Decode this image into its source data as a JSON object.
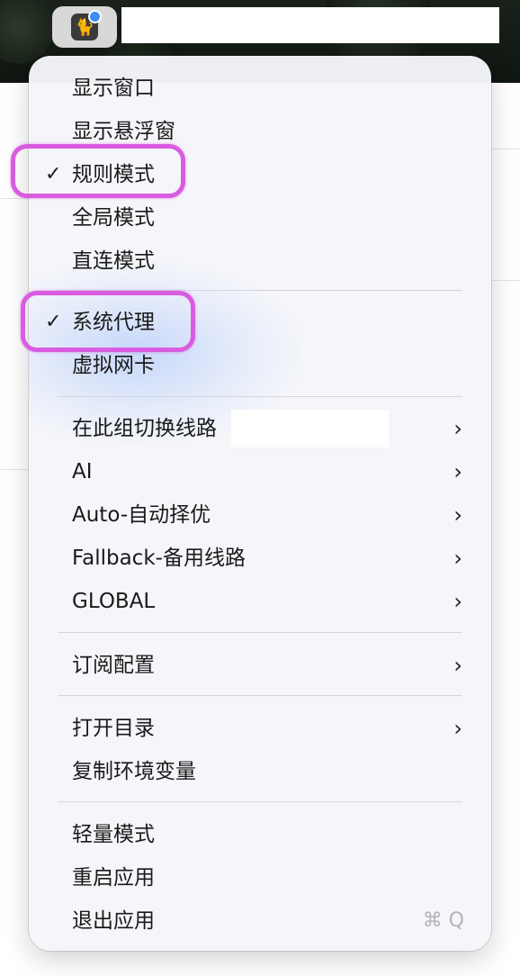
{
  "menu": {
    "group1": [
      {
        "label": "显示窗口"
      },
      {
        "label": "显示悬浮窗"
      },
      {
        "label": "规则模式",
        "checked": true
      },
      {
        "label": "全局模式"
      },
      {
        "label": "直连模式"
      }
    ],
    "group2": [
      {
        "label": "系统代理",
        "checked": true
      },
      {
        "label": "虚拟网卡"
      }
    ],
    "group3": [
      {
        "label": "在此组切换线路"
      },
      {
        "label": "AI"
      },
      {
        "label": "Auto-自动择优"
      },
      {
        "label": "Fallback-备用线路"
      },
      {
        "label": "GLOBAL"
      }
    ],
    "group4": [
      {
        "label": "订阅配置"
      }
    ],
    "group5": [
      {
        "label": "打开目录"
      },
      {
        "label": "复制环境变量"
      }
    ],
    "group6": [
      {
        "label": "轻量模式"
      },
      {
        "label": "重启应用"
      },
      {
        "label": "退出应用",
        "shortcut": "⌘ Q"
      }
    ]
  },
  "glyphs": {
    "check": "✓",
    "chevron": "›",
    "cat": "🐈"
  },
  "colors": {
    "highlight": "#d95ce0",
    "menu_bg": "#f5f6fa",
    "tray_dot": "#3b8cf5"
  }
}
